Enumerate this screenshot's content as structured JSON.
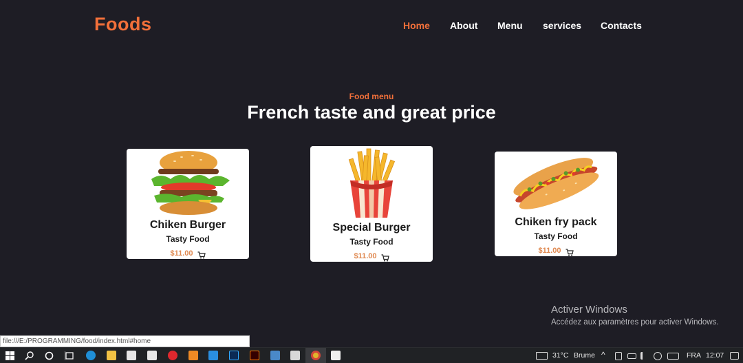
{
  "brand": {
    "logo": "Foods"
  },
  "nav": {
    "items": [
      {
        "label": "Home",
        "active": true
      },
      {
        "label": "About",
        "active": false
      },
      {
        "label": "Menu",
        "active": false
      },
      {
        "label": "services",
        "active": false
      },
      {
        "label": "Contacts",
        "active": false
      }
    ]
  },
  "menu_section": {
    "subtitle": "Food menu",
    "title": "French taste and great price"
  },
  "cards": [
    {
      "name": "Chiken Burger",
      "tag": "Tasty Food",
      "price": "$11.00",
      "image": "burger-image"
    },
    {
      "name": "Special Burger",
      "tag": "Tasty Food",
      "price": "$11.00",
      "image": "fries-image"
    },
    {
      "name": "Chiken fry pack",
      "tag": "Tasty Food",
      "price": "$11.00",
      "image": "hotdog-image"
    }
  ],
  "watermark": {
    "line1": "Activer Windows",
    "line2": "Accédez aux paramètres pour activer Windows."
  },
  "statusbar": {
    "url": "file:///E:/PROGRAMMING/food/index.html#home"
  },
  "taskbar": {
    "weather": "31°C",
    "weather_desc": "Brume",
    "language": "FRA",
    "time": "12:07"
  },
  "colors": {
    "accent": "#f2703a",
    "background": "#1e1d25",
    "card": "#ffffff",
    "price": "#e08a52"
  }
}
